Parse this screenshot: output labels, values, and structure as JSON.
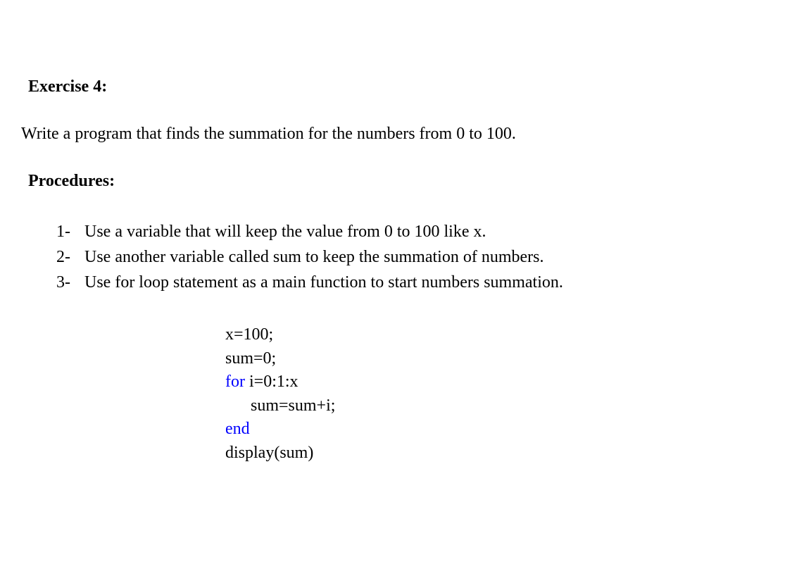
{
  "heading": "Exercise 4:",
  "description": "Write a program that finds the summation for the numbers from 0 to 100.",
  "procedures_label": "Procedures:",
  "procedures": [
    {
      "num": "1-",
      "text": "Use a variable that will keep the value from 0 to 100 like x."
    },
    {
      "num": "2-",
      "text": "Use another variable called sum to keep the summation of numbers."
    },
    {
      "num": "3-",
      "text": "Use for loop statement as a main function to start numbers summation."
    }
  ],
  "code": {
    "line1": "x=100;",
    "line2": "sum=0;",
    "line3_kw": "for",
    "line3_rest": " i=0:1:x",
    "line4": "sum=sum+i;",
    "line5_kw": "end",
    "line6": "display(sum)"
  }
}
